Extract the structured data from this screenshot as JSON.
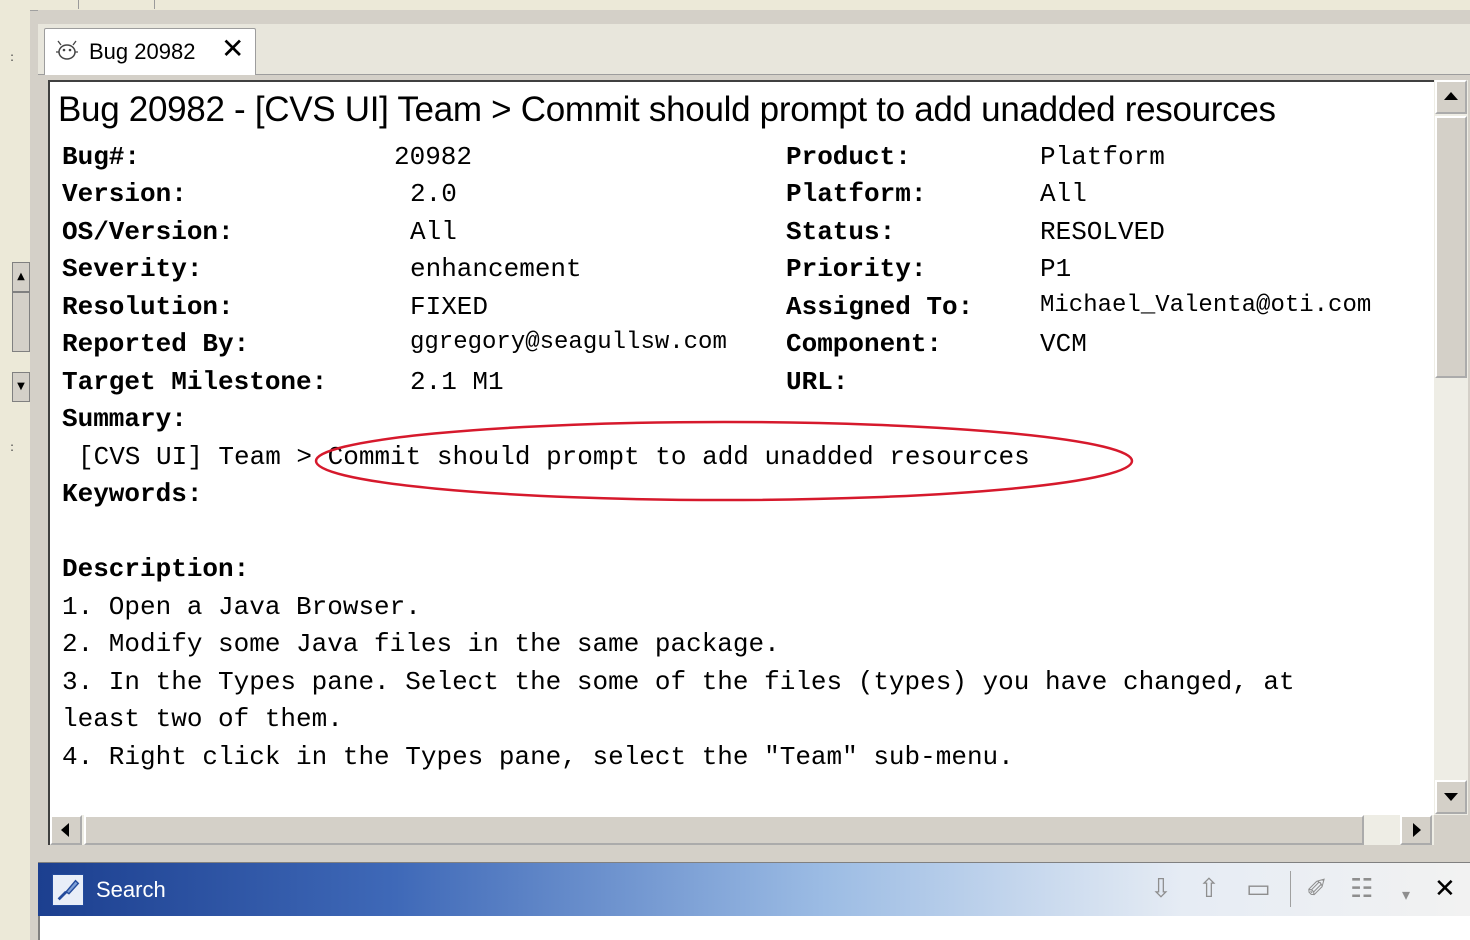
{
  "tab": {
    "label": "Bug 20982",
    "close": "✕"
  },
  "heading": "Bug 20982 - [CVS UI] Team > Commit should prompt to add unadded resources",
  "fields_left": [
    {
      "label": "Bug#:",
      "value": "20982"
    },
    {
      "label": "Version:",
      "value": "2.0"
    },
    {
      "label": "OS/Version:",
      "value": "All"
    },
    {
      "label": "Severity:",
      "value": "enhancement"
    },
    {
      "label": "Resolution:",
      "value": "FIXED"
    },
    {
      "label": "Reported By:",
      "value": "ggregory@seagullsw.com"
    },
    {
      "label": "Target Milestone:",
      "value": "2.1 M1"
    }
  ],
  "fields_right": [
    {
      "label": "Product:",
      "value": "Platform"
    },
    {
      "label": "Platform:",
      "value": "All"
    },
    {
      "label": "Status:",
      "value": "RESOLVED"
    },
    {
      "label": "Priority:",
      "value": "P1"
    },
    {
      "label": "Assigned To:",
      "value": "Michael_Valenta@oti.com"
    },
    {
      "label": "Component:",
      "value": "VCM"
    },
    {
      "label": "URL:",
      "value": ""
    }
  ],
  "summary": {
    "label": "Summary:",
    "value": "[CVS UI] Team > Commit should prompt to add unadded resources"
  },
  "keywords": {
    "label": "Keywords:"
  },
  "description": {
    "label": "Description:",
    "lines": [
      "1. Open a Java Browser.",
      "2. Modify some Java files in the same package.",
      "3. In the Types pane. Select the some of the files (types) you have changed, at",
      "least two of them.",
      "4. Right click in the Types pane, select the \"Team\" sub-menu."
    ]
  },
  "search_view": {
    "title": "Search",
    "toolbar_icons": [
      "arrow-down-icon",
      "arrow-up-icon",
      "minimize-icon",
      "pin-icon",
      "history-icon",
      "view-menu-icon",
      "close-icon"
    ]
  },
  "colors": {
    "annotation": "#d6192c",
    "view_title_start": "#1c3f8f"
  }
}
